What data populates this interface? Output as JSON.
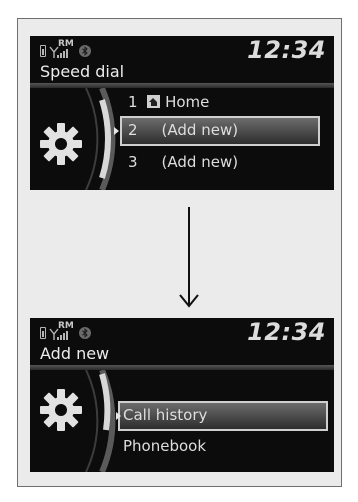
{
  "status": {
    "signal_label": "RM",
    "clock": "12:34"
  },
  "screen1": {
    "title": "Speed dial",
    "items": [
      {
        "number": "1",
        "label": "Home",
        "icon": "home-icon"
      },
      {
        "number": "2",
        "label": "(Add new)",
        "selected": true
      },
      {
        "number": "3",
        "label": "(Add new)"
      }
    ]
  },
  "screen2": {
    "title": "Add new",
    "items": [
      {
        "label": "Call history",
        "selected": true
      },
      {
        "label": "Phonebook"
      }
    ]
  },
  "icons": [
    "battery-icon",
    "signal-icon",
    "bluetooth-icon",
    "gear-icon",
    "down-arrow-icon"
  ],
  "colors": {
    "screen_bg": "#0c0c0c",
    "text": "#dedede",
    "highlight_border": "#cfcfcf"
  }
}
